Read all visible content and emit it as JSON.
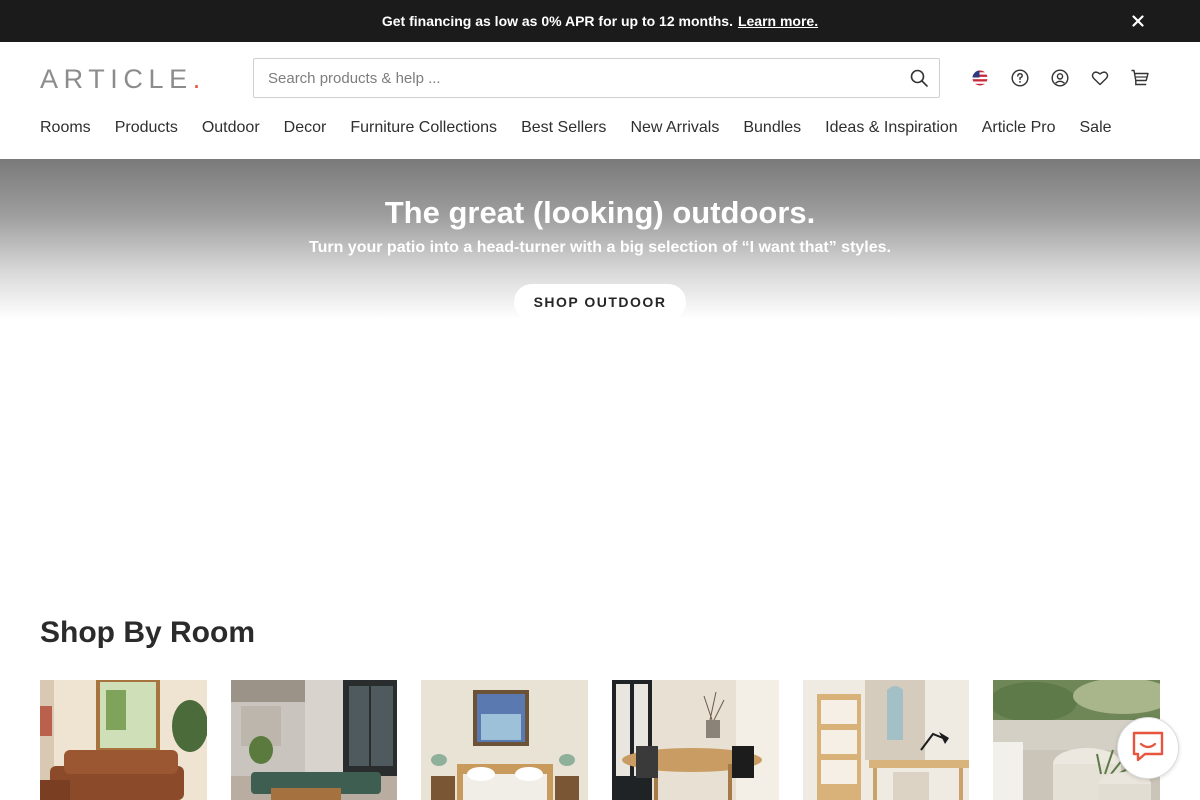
{
  "promo": {
    "text": "Get financing as low as 0% APR for up to 12 months.",
    "link": "Learn more.",
    "close_icon": "close-icon"
  },
  "header": {
    "logo_text": "ARTICLE",
    "logo_dot": ".",
    "search_placeholder": "Search products & help ...",
    "search_icon": "search-icon",
    "utility_icons": [
      "us-flag-icon",
      "help-icon",
      "account-icon",
      "heart-icon",
      "cart-icon"
    ]
  },
  "nav": {
    "items": [
      "Rooms",
      "Products",
      "Outdoor",
      "Decor",
      "Furniture Collections",
      "Best Sellers",
      "New Arrivals",
      "Bundles",
      "Ideas & Inspiration",
      "Article Pro",
      "Sale"
    ]
  },
  "hero": {
    "title": "The great (looking) outdoors.",
    "subtitle": "Turn your patio into a head-turner with a big selection of “I want that” styles.",
    "cta": "SHOP OUTDOOR"
  },
  "shop_by_room": {
    "title": "Shop By Room",
    "tiles": [
      "living-room",
      "outdoor",
      "bedroom",
      "dining-room",
      "office",
      "patio"
    ]
  },
  "chat": {
    "icon": "chat-icon"
  },
  "colors": {
    "promo_bg": "#1b1b1b",
    "logo": "#8c8c8c",
    "logo_accent": "#e8553e",
    "text": "#2b2b2b",
    "chat_accent": "#e8553e"
  }
}
